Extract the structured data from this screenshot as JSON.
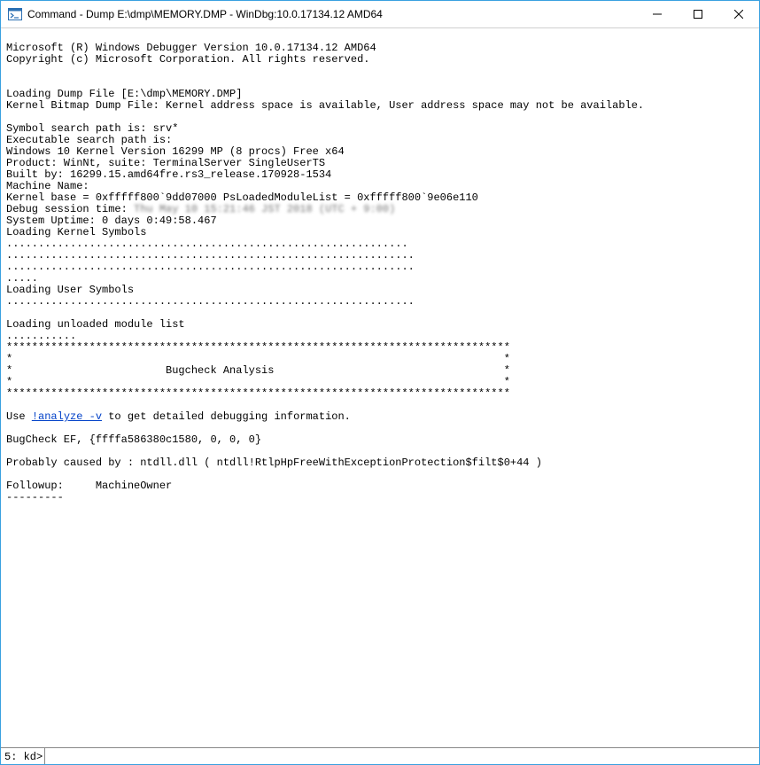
{
  "titlebar": {
    "title": "Command - Dump E:\\dmp\\MEMORY.DMP - WinDbg:10.0.17134.12 AMD64"
  },
  "output": {
    "pre1": "\nMicrosoft (R) Windows Debugger Version 10.0.17134.12 AMD64\nCopyright (c) Microsoft Corporation. All rights reserved.\n\n\nLoading Dump File [E:\\dmp\\MEMORY.DMP]\nKernel Bitmap Dump File: Kernel address space is available, User address space may not be available.\n\nSymbol search path is: srv*\nExecutable search path is: \nWindows 10 Kernel Version 16299 MP (8 procs) Free x64\nProduct: WinNt, suite: TerminalServer SingleUserTS\nBuilt by: 16299.15.amd64fre.rs3_release.170928-1534\nMachine Name:\nKernel base = 0xfffff800`9dd07000 PsLoadedModuleList = 0xfffff800`9e06e110",
    "debug_session_prefix": "Debug session time: ",
    "debug_session_blurred": "Thu May 10 15:21:46 JST 2018 (UTC + 9:00)",
    "pre2": "System Uptime: 0 days 0:49:58.467\nLoading Kernel Symbols\n...............................................................\n................................................................\n................................................................\n.....\nLoading User Symbols\n................................................................\n\nLoading unloaded module list\n...........\n*******************************************************************************\n*                                                                             *\n*                        Bugcheck Analysis                                    *\n*                                                                             *\n*******************************************************************************\n\nUse ",
    "analyze_link": "!analyze -v",
    "pre3": " to get detailed debugging information.\n\nBugCheck EF, {ffffa586380c1580, 0, 0, 0}\n\nProbably caused by : ntdll.dll ( ntdll!RtlpHpFreeWithExceptionProtection$filt$0+44 )\n\nFollowup:     MachineOwner\n---------\n"
  },
  "prompt": {
    "label": "5: kd>",
    "value": ""
  }
}
